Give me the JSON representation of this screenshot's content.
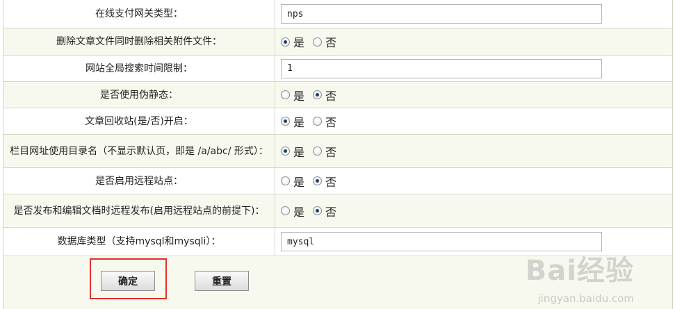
{
  "settings": [
    {
      "label": "在线支付网关类型：",
      "type": "text",
      "value": "nps"
    },
    {
      "label": "删除文章文件同时删除相关附件文件：",
      "type": "radio",
      "selected": "yes"
    },
    {
      "label": "网站全局搜索时间限制：",
      "type": "text",
      "value": "1"
    },
    {
      "label": "是否使用伪静态：",
      "type": "radio",
      "selected": "no"
    },
    {
      "label": "文章回收站(是/否)开启：",
      "type": "radio",
      "selected": "yes"
    },
    {
      "label": "栏目网址使用目录名（不显示默认页，即是 /a/abc/ 形式）：",
      "type": "radio",
      "selected": "yes"
    },
    {
      "label": "是否启用远程站点：",
      "type": "radio",
      "selected": "no"
    },
    {
      "label": "是否发布和编辑文档时远程发布(启用远程站点的前提下)：",
      "type": "radio",
      "selected": "no"
    },
    {
      "label": "数据库类型（支持mysql和mysqli）：",
      "type": "text",
      "value": "mysql"
    }
  ],
  "radio": {
    "yes": "是",
    "no": "否"
  },
  "buttons": {
    "confirm": "确定",
    "reset": "重置"
  },
  "watermark": {
    "logo": "Bai经验",
    "url": "jingyan.baidu.com"
  },
  "colors": {
    "highlight": "#e0312c",
    "row_alt": "#f8f9ee",
    "radio_dot": "#1f3e6e"
  }
}
